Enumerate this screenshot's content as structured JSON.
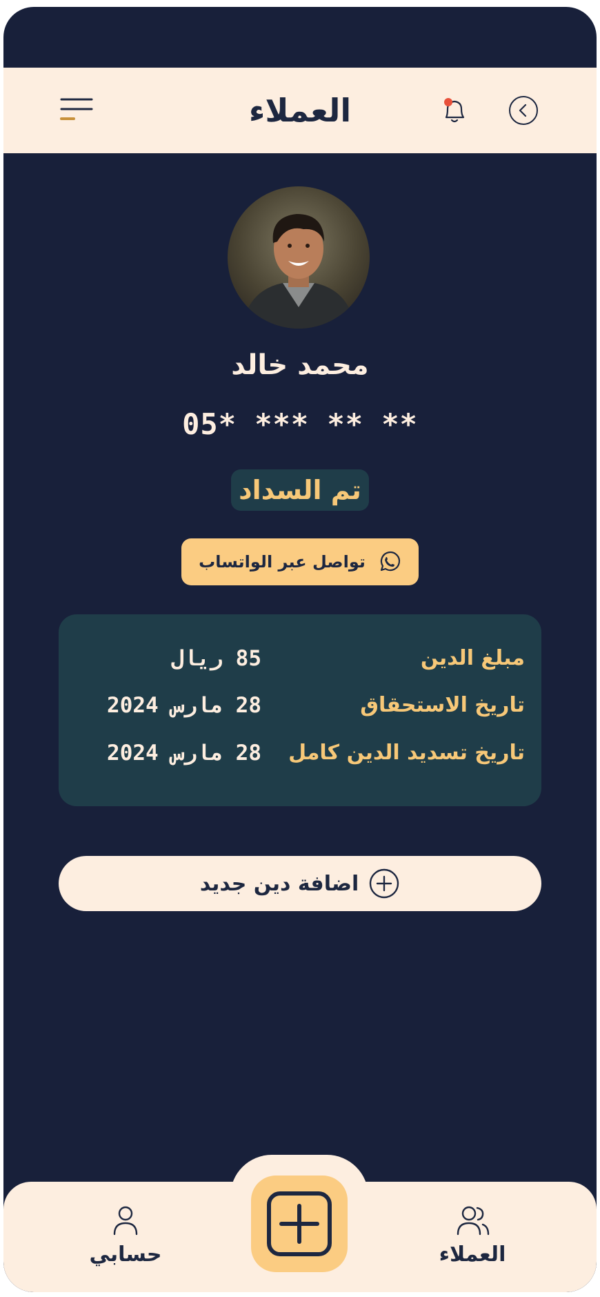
{
  "header": {
    "title": "العملاء",
    "menu_icon": "menu-icon",
    "bell_icon": "bell-icon",
    "back_icon": "chevron-left-circle-icon",
    "notification_dot_color": "#e8503a"
  },
  "customer": {
    "name": "محمد خالد",
    "phone": "05* *** ** **",
    "status": "تم السداد"
  },
  "whatsapp_button": {
    "label": "تواصل عبر الواتساب",
    "icon": "whatsapp-icon"
  },
  "debt_details": [
    {
      "label": "مبلغ الدين",
      "value": "85 ريال"
    },
    {
      "label": "تاريخ الاستحقاق",
      "value": "28 مارس 2024"
    },
    {
      "label": "تاريخ تسديد الدين كامل",
      "value": "28 مارس 2024"
    }
  ],
  "add_debt_button": {
    "label": "اضافة دين جديد",
    "icon": "plus-circle-icon"
  },
  "bottom_nav": {
    "customers": "العملاء",
    "account": "حسابي",
    "fab_icon": "plus-square-icon"
  },
  "colors": {
    "background": "#18203a",
    "cream": "#fdeee0",
    "accent": "#fbcc82",
    "card": "#1f3d49",
    "gold_text": "#f7c878"
  }
}
